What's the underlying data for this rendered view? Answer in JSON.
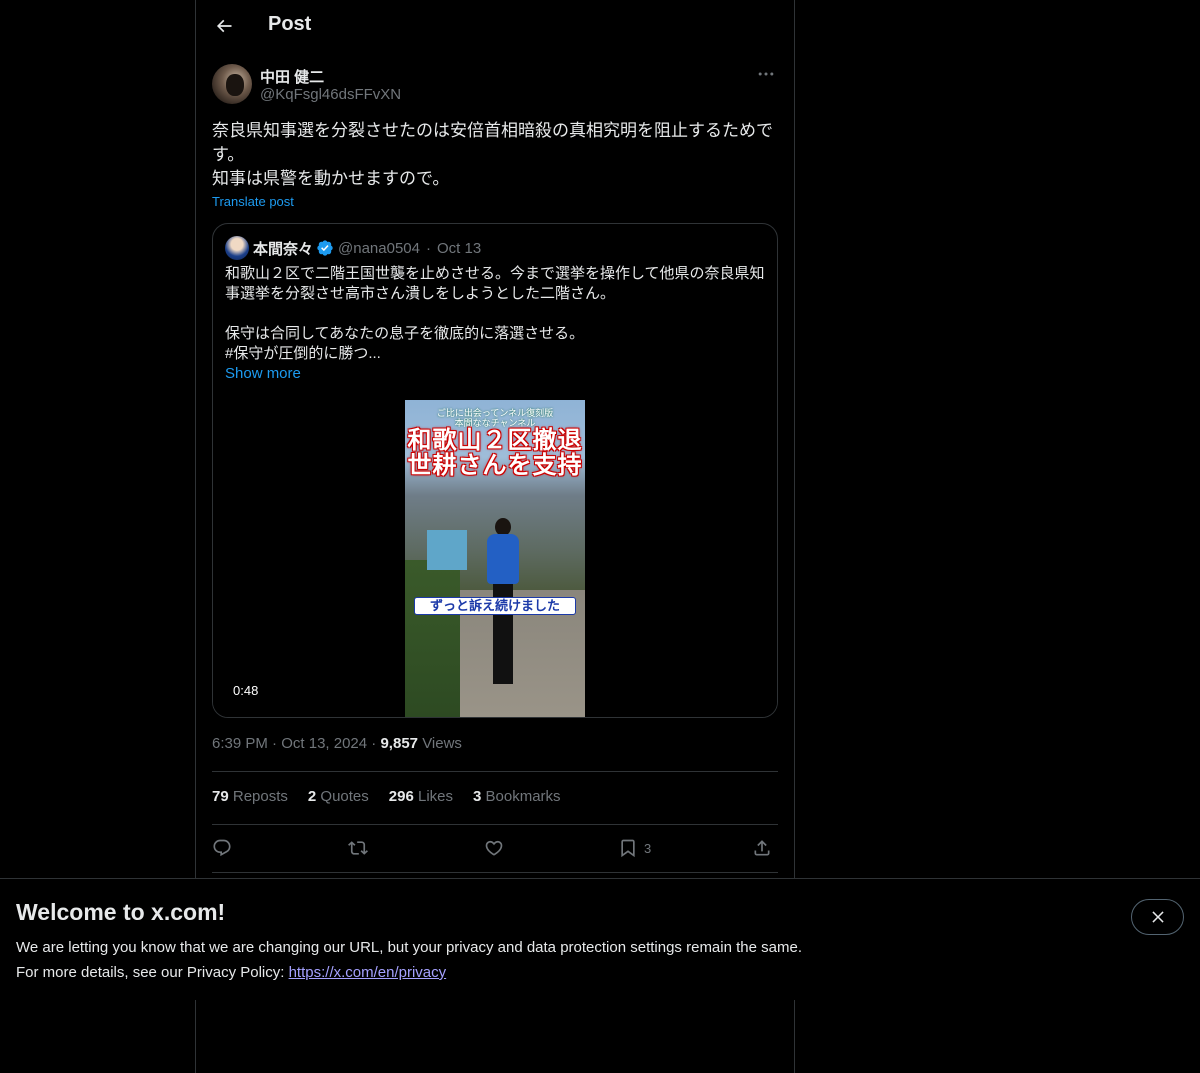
{
  "header": {
    "title": "Post"
  },
  "post": {
    "author_name": "中田 健二",
    "author_handle": "@KqFsgl46dsFFvXN",
    "text_lines": [
      "奈良県知事選を分裂させたのは安倍首相暗殺の真相究明を阻止するためで",
      "す。",
      "知事は県警を動かせますので。"
    ],
    "translate_label": "Translate post",
    "time": "6:39 PM",
    "date": "Oct 13, 2024",
    "views_count": "9,857",
    "views_label": "Views"
  },
  "quote": {
    "author_name": "本間奈々",
    "author_handle": "@nana0504",
    "date": "Oct 13",
    "text": "和歌山２区で二階王国世襲を止めさせる。今まで選挙を操作して他県の奈良県知\n事選挙を分裂させ高市さん潰しをしようとした二階さん。\n\n保守は合同してあなたの息子を徹底的に落選させる。\n#保守が圧倒的に勝つ...",
    "show_more": "Show more",
    "video": {
      "top_text": "ご比に出会ってンネル復刻版\n本間ななチャンネル",
      "title_line1": "和歌山２区撤退",
      "title_line2": "世耕さんを支持",
      "caption": "ずっと訴え続けました",
      "duration": "0:48"
    }
  },
  "stats": {
    "reposts_count": "79",
    "reposts_label": "Reposts",
    "quotes_count": "2",
    "quotes_label": "Quotes",
    "likes_count": "296",
    "likes_label": "Likes",
    "bookmarks_count": "3",
    "bookmarks_label": "Bookmarks"
  },
  "actions": {
    "bookmark_count": "3"
  },
  "banner": {
    "title": "Welcome to x.com!",
    "line1": "We are letting you know that we are changing our URL, but your privacy and data protection settings remain the same.",
    "line2_prefix": "For more details, see our Privacy Policy: ",
    "link": "https://x.com/en/privacy"
  },
  "colors": {
    "accent": "#1d9bf0",
    "muted": "#71767b",
    "border": "#2f3336",
    "background": "#000000"
  }
}
